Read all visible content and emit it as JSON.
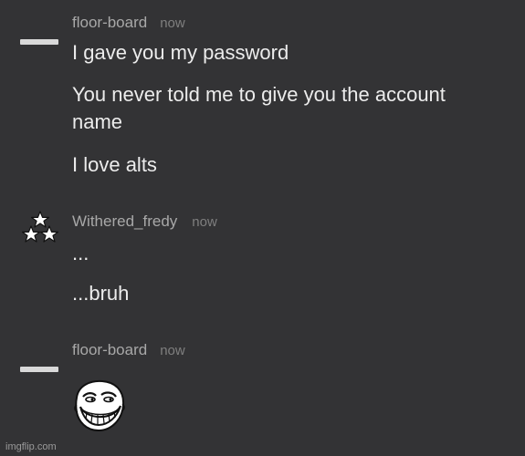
{
  "groups": [
    {
      "username": "floor-board",
      "timestamp": "now",
      "avatar_icon": "dash-avatar-icon",
      "messages": [
        "I gave you my password",
        "You never told me to give you the account name",
        "I love alts"
      ]
    },
    {
      "username": "Withered_fredy",
      "timestamp": "now",
      "avatar_icon": "stars-avatar-icon",
      "messages": [
        "...",
        "...bruh"
      ]
    },
    {
      "username": "floor-board",
      "timestamp": "now",
      "avatar_icon": "dash-avatar-icon",
      "attachment_icon": "trollface-emoji-icon"
    }
  ],
  "watermark": "imgflip.com"
}
